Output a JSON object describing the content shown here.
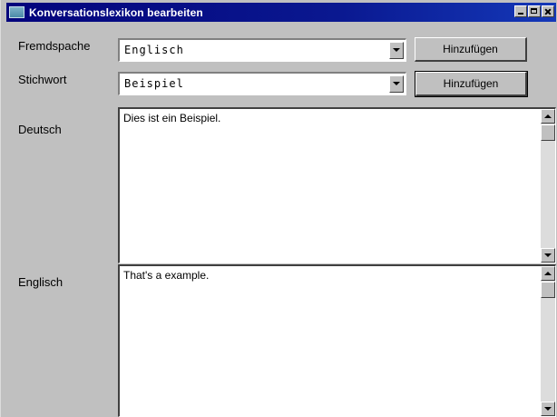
{
  "window": {
    "title": "Konversationslexikon bearbeiten",
    "icons": {
      "app": "app-icon",
      "minimize": "minimize-icon",
      "maximize": "maximize-icon",
      "close": "close-icon"
    }
  },
  "form": {
    "foreign_language": {
      "label": "Fremdspache",
      "value": "Englisch",
      "button_label": "Hinzufügen"
    },
    "keyword": {
      "label": "Stichwort",
      "value": "Beispiel",
      "button_label": "Hinzufügen"
    },
    "german": {
      "label": "Deutsch",
      "text": "Dies ist ein Beispiel."
    },
    "english": {
      "label": "Englisch",
      "text": "That's a example."
    }
  },
  "colors": {
    "title_bar": "#03047c",
    "face": "#c0c0c0",
    "field": "#ffffff"
  }
}
